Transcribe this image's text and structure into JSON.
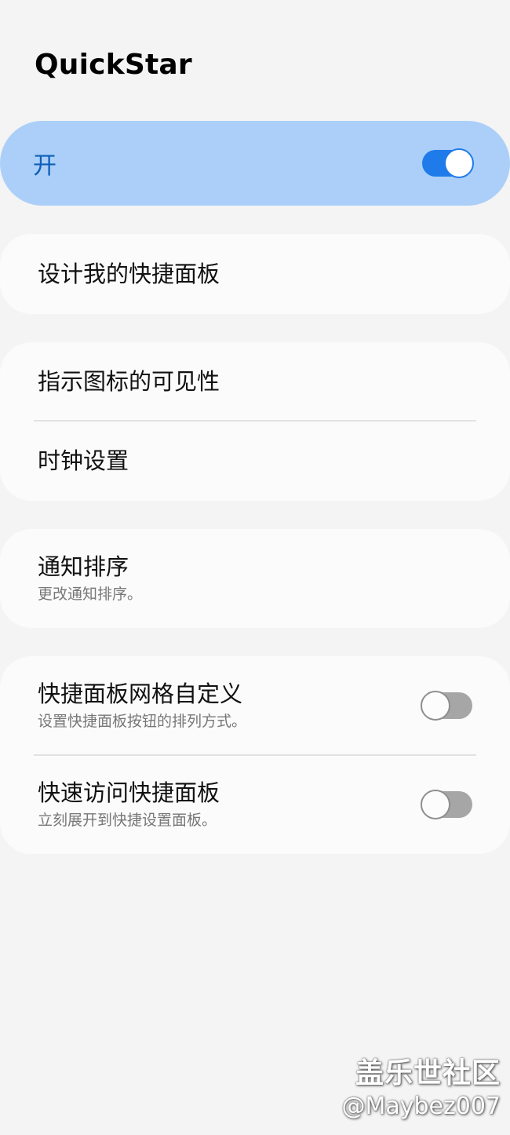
{
  "header": {
    "title": "QuickStar"
  },
  "master_switch": {
    "label": "开",
    "state": "on"
  },
  "groups": [
    {
      "items": [
        {
          "title": "设计我的快捷面板"
        }
      ]
    },
    {
      "items": [
        {
          "title": "指示图标的可见性"
        },
        {
          "title": "时钟设置"
        }
      ]
    },
    {
      "items": [
        {
          "title": "通知排序",
          "subtitle": "更改通知排序。"
        }
      ]
    },
    {
      "items": [
        {
          "title": "快捷面板网格自定义",
          "subtitle": "设置快捷面板按钮的排列方式。",
          "toggle": "off"
        },
        {
          "title": "快速访问快捷面板",
          "subtitle": "立刻展开到快捷设置面板。",
          "toggle": "off"
        }
      ]
    }
  ],
  "watermark": {
    "line1": "盖乐世社区",
    "line2": "@Maybez007"
  },
  "colors": {
    "accent": "#1f7bea",
    "master_bg": "#abcff8",
    "master_text": "#0c5fb8",
    "card_bg": "#fbfbfb",
    "page_bg": "#f4f4f4",
    "toggle_off": "#a6a6a6"
  }
}
